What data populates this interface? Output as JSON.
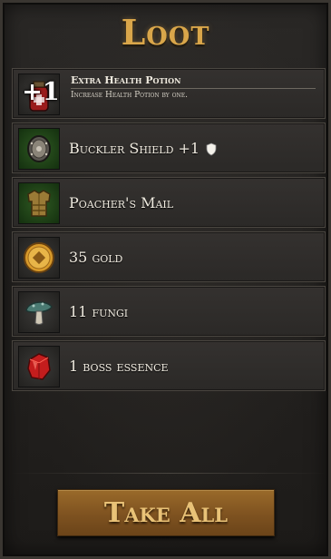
{
  "title": "Loot",
  "perk": {
    "badge": "+1",
    "name": "Extra Health Potion",
    "description": "Increase Health Potion by one.",
    "icon": "health-potion-icon"
  },
  "items": [
    {
      "label": "Buckler Shield +1",
      "icon": "buckler-shield-icon",
      "trait_icon": "shield-icon"
    },
    {
      "label": "Poacher's Mail",
      "icon": "leather-armor-icon"
    },
    {
      "label": "35 gold",
      "icon": "gold-coin-icon"
    },
    {
      "label": "11 fungi",
      "icon": "mushroom-icon"
    },
    {
      "label": "1 boss essence",
      "icon": "red-crystal-icon"
    }
  ],
  "actions": {
    "take_all": "Take All"
  },
  "colors": {
    "title": "#d9a64a",
    "button": "#7e5220",
    "button_text": "#e9c277"
  }
}
